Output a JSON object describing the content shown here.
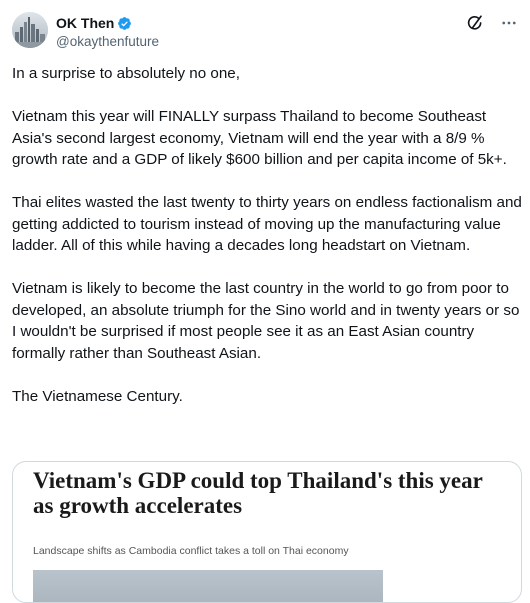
{
  "author": {
    "display_name": "OK Then",
    "handle": "@okaythenfuture",
    "verified": true,
    "avatar_icon": "city-skyline-avatar"
  },
  "actions": {
    "grok_icon": "grok-icon",
    "more_icon": "more-icon"
  },
  "tweet": {
    "paragraphs": [
      "In a surprise to absolutely no one,",
      "Vietnam this year will FINALLY surpass Thailand to become Southeast Asia's second largest economy, Vietnam will end the year with a 8/9 % growth rate and a GDP of likely $600 billion and per capita income of 5k+.",
      "Thai elites wasted the last twenty to thirty years on endless factionalism and getting addicted to tourism instead of moving up the manufacturing value ladder. All of this while having a decades long headstart on Vietnam.",
      "Vietnam is likely to become the last country in the world to go from poor to developed, an absolute triumph for the Sino world and in twenty years or so I wouldn't be surprised if most people see it as an East Asian country formally rather than Southeast Asian.",
      "The Vietnamese Century."
    ]
  },
  "card": {
    "headline": "Vietnam's GDP could top Thailand's this year as growth accelerates",
    "subheadline": "Landscape shifts as Cambodia conflict takes a toll on Thai economy"
  },
  "colors": {
    "text": "#0f1419",
    "secondary": "#536471",
    "verified": "#1d9bf0",
    "border": "#cfd9de"
  }
}
